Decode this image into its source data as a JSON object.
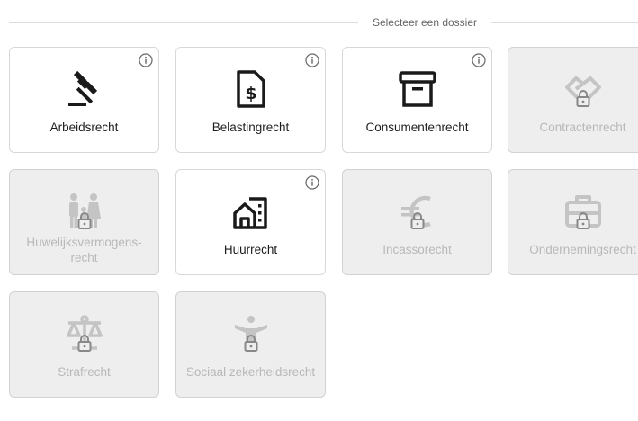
{
  "header": {
    "title": "Selecteer een dossier"
  },
  "cards": [
    {
      "label": "Arbeidsrecht",
      "icon": "gavel-icon",
      "locked": false
    },
    {
      "label": "Belastingrecht",
      "icon": "tax-document-icon",
      "locked": false
    },
    {
      "label": "Consumentenrecht",
      "icon": "archive-box-icon",
      "locked": false
    },
    {
      "label": "Contractenrecht",
      "icon": "handshake-icon",
      "locked": true
    },
    {
      "label": "Huwelijksvermogens-recht",
      "icon": "family-icon",
      "locked": true
    },
    {
      "label": "Huurrecht",
      "icon": "rental-building-icon",
      "locked": false
    },
    {
      "label": "Incassorecht",
      "icon": "euro-icon",
      "locked": true
    },
    {
      "label": "Ondernemingsrecht",
      "icon": "briefcase-icon",
      "locked": true
    },
    {
      "label": "Strafrecht",
      "icon": "scales-icon",
      "locked": true
    },
    {
      "label": "Sociaal zekerheidsrecht",
      "icon": "person-icon",
      "locked": true
    }
  ],
  "colors": {
    "icon_active": "#1a1a1a",
    "icon_locked": "#c4c4c4",
    "locked_bg": "#eeeeee"
  }
}
